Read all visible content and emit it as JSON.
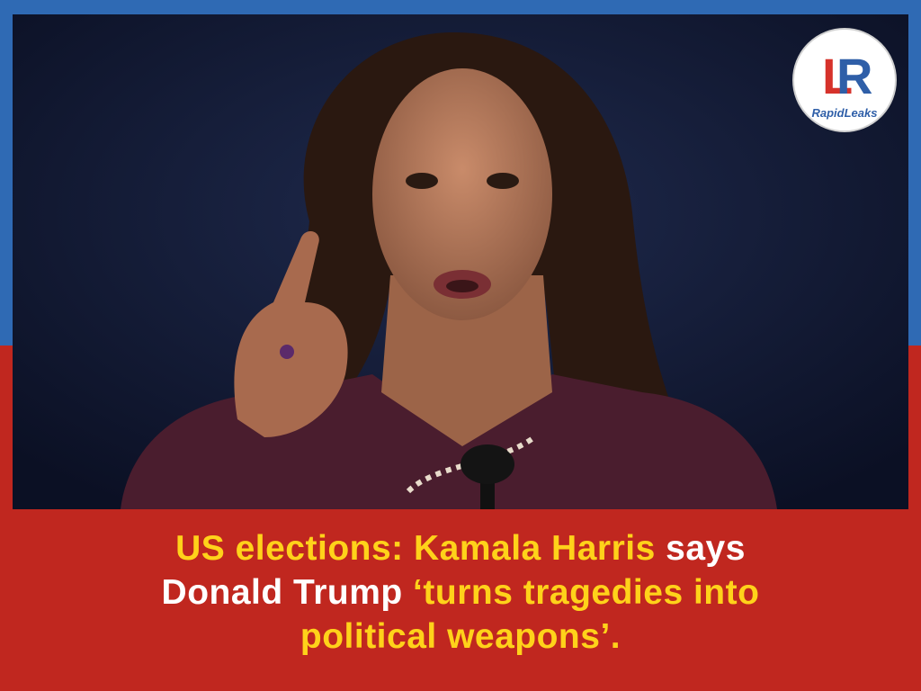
{
  "logo": {
    "brand_text": "RapidLeaks",
    "icon": "lr-monogram-icon",
    "colors": {
      "l": "#d6322b",
      "r": "#2f5fa8"
    }
  },
  "headline": {
    "line1": {
      "part1": "US elections: Kamala Harris",
      "part2": " says"
    },
    "line2": {
      "part1": "Donald Trump",
      "part2": " ‘turns tragedies into"
    },
    "line3": {
      "part1": "political weapons’."
    }
  },
  "colors": {
    "top_band": "#2f6ab4",
    "bottom_band": "#c0271f",
    "highlight_text": "#ffd21a",
    "plain_text": "#ffffff"
  }
}
